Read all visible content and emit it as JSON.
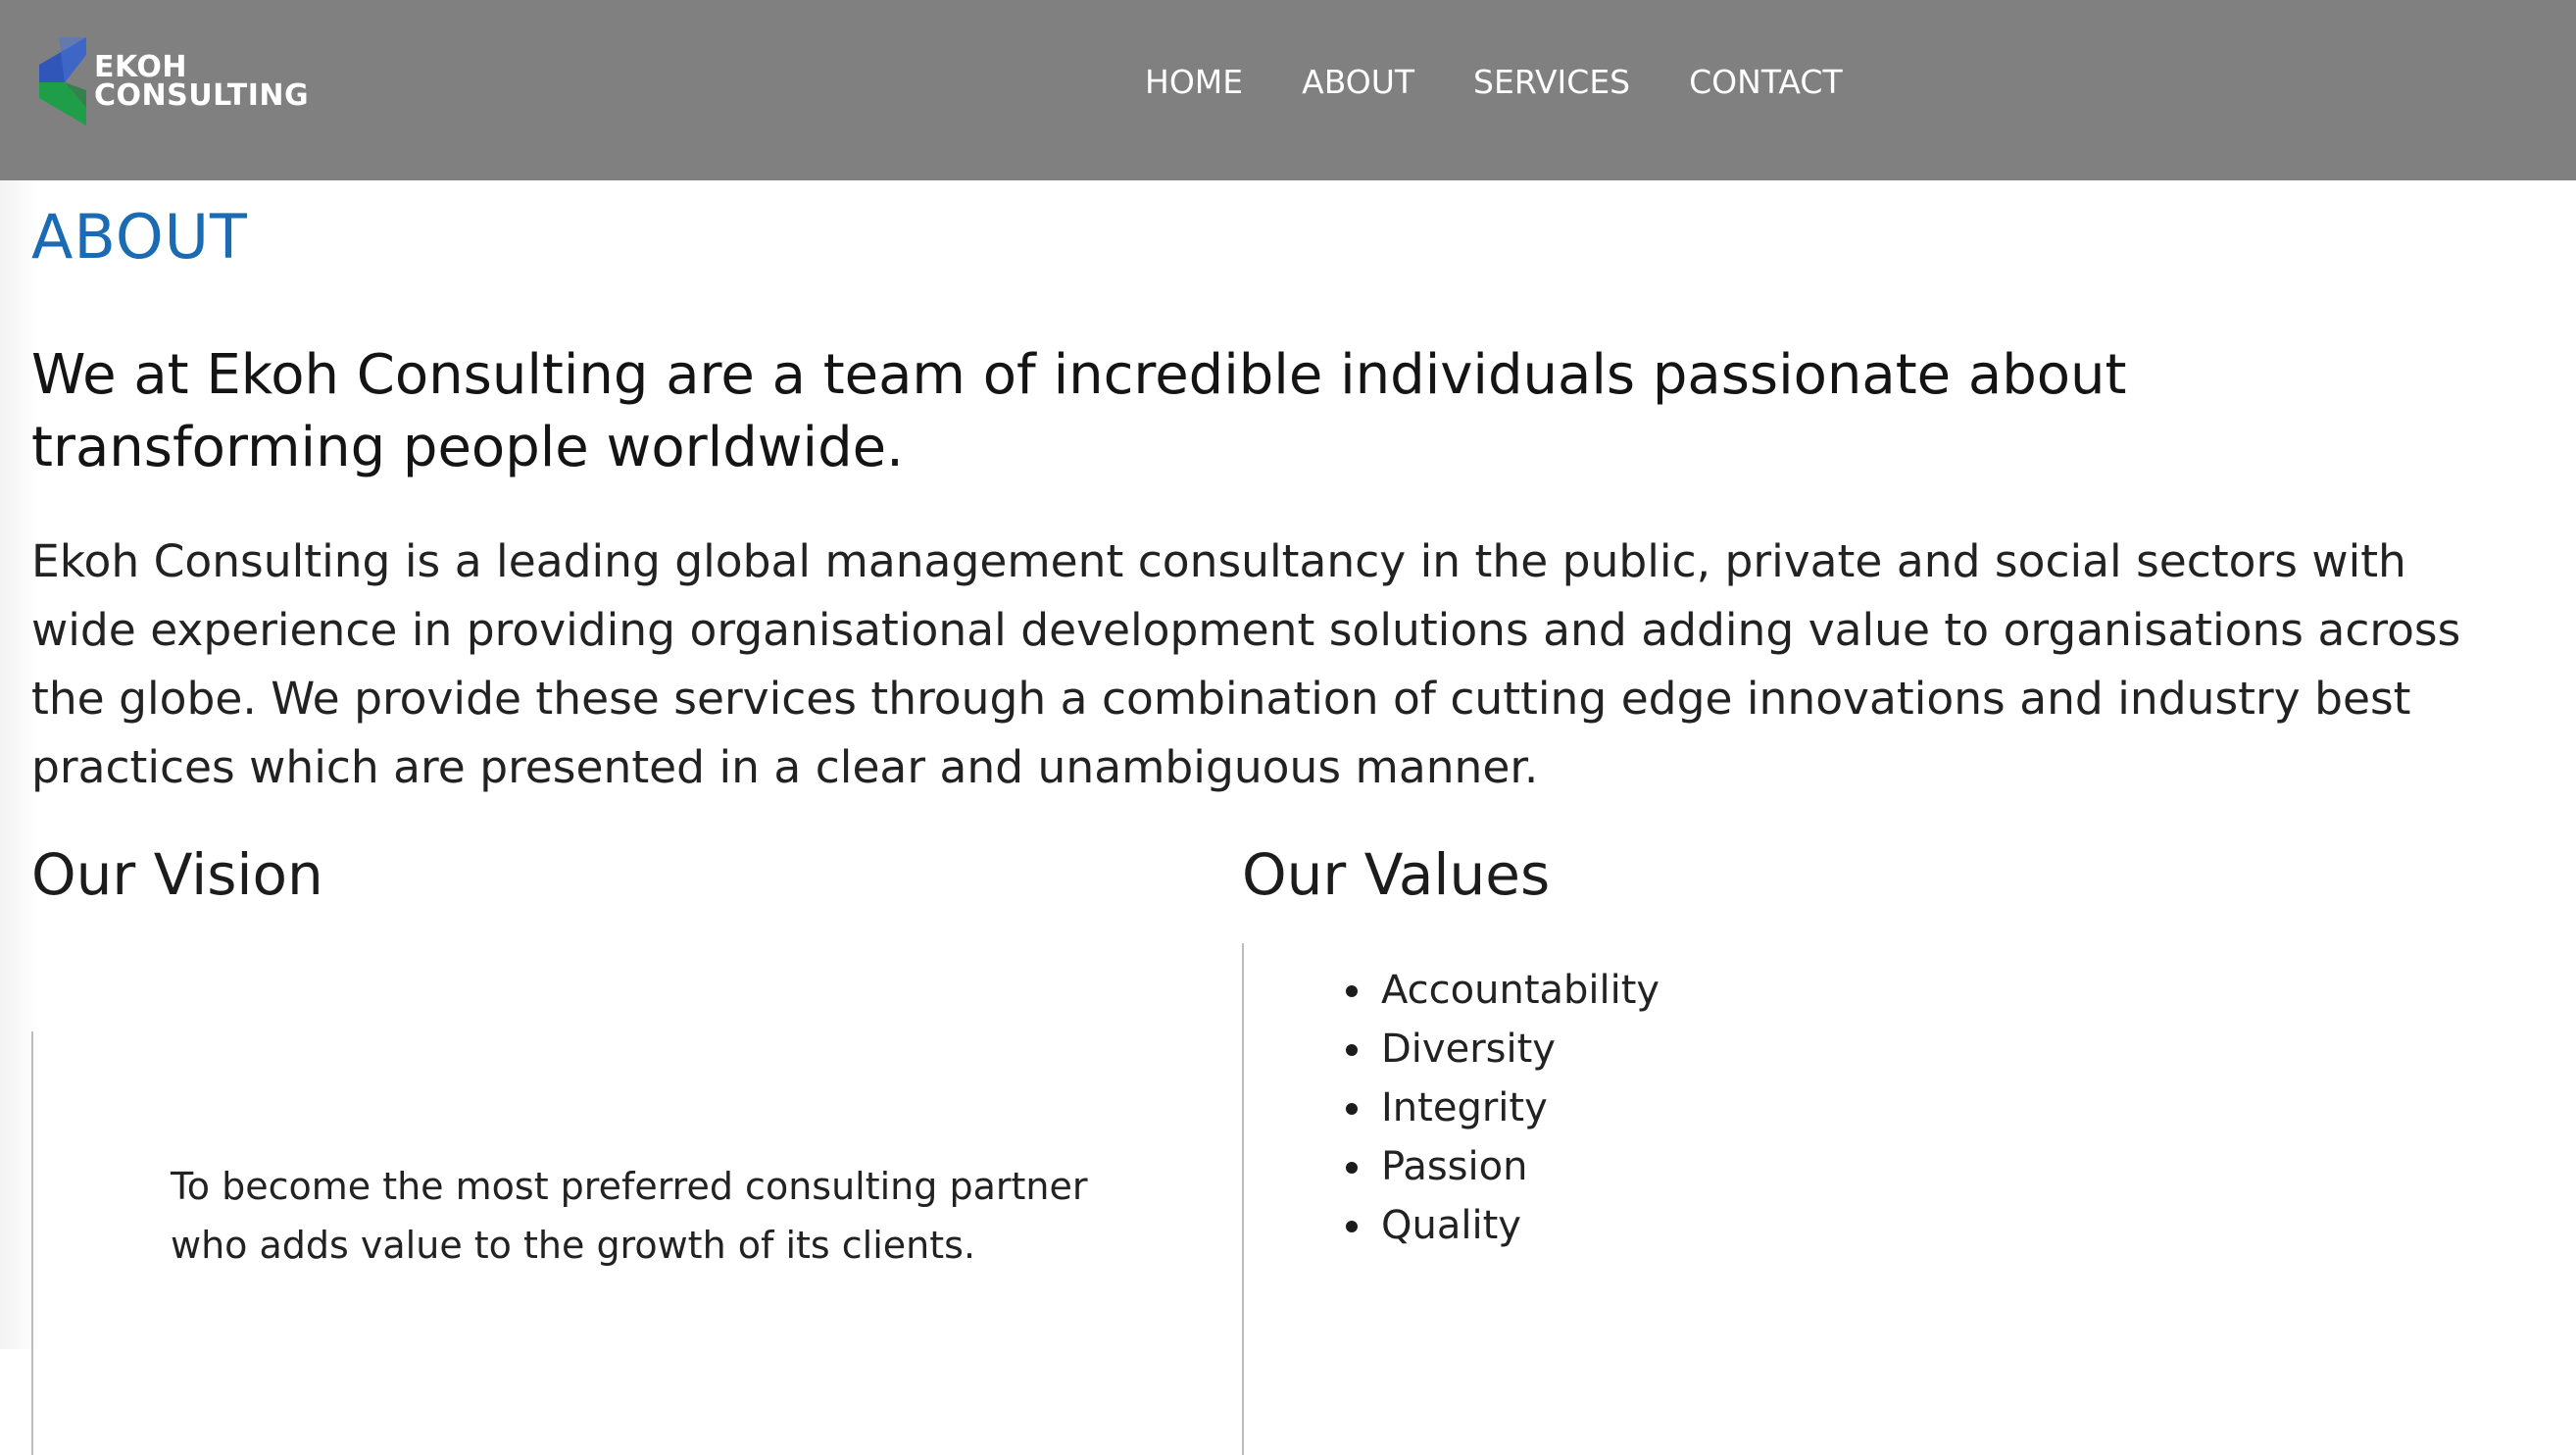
{
  "header": {
    "logo": {
      "line1": "EKOH",
      "line2": "CONSULTING",
      "colors": {
        "blue": "#2f56b8",
        "green": "#1f9e4a",
        "text": "#ffffff"
      }
    },
    "nav": [
      "HOME",
      "ABOUT",
      "SERVICES",
      "CONTACT"
    ],
    "background": "#808080"
  },
  "about": {
    "title": "ABOUT",
    "title_color": "#1a6bb3",
    "lead": "We at Ekoh Consulting are a team of incredible individuals passionate about transforming people worldwide.",
    "intro": "Ekoh Consulting is a leading global management consultancy in the public, private and social sectors with wide experience in providing organisational development solutions and adding value to organisations across the globe. We provide these services through a combination of cutting edge innovations and industry best practices which are presented in a clear and unambiguous manner."
  },
  "vision": {
    "title": "Our Vision",
    "text": "To become the most preferred consulting partner who adds value to the growth of its clients."
  },
  "values": {
    "title": "Our Values",
    "items": [
      "Accountability",
      "Diversity",
      "Integrity",
      "Passion",
      "Quality"
    ]
  }
}
